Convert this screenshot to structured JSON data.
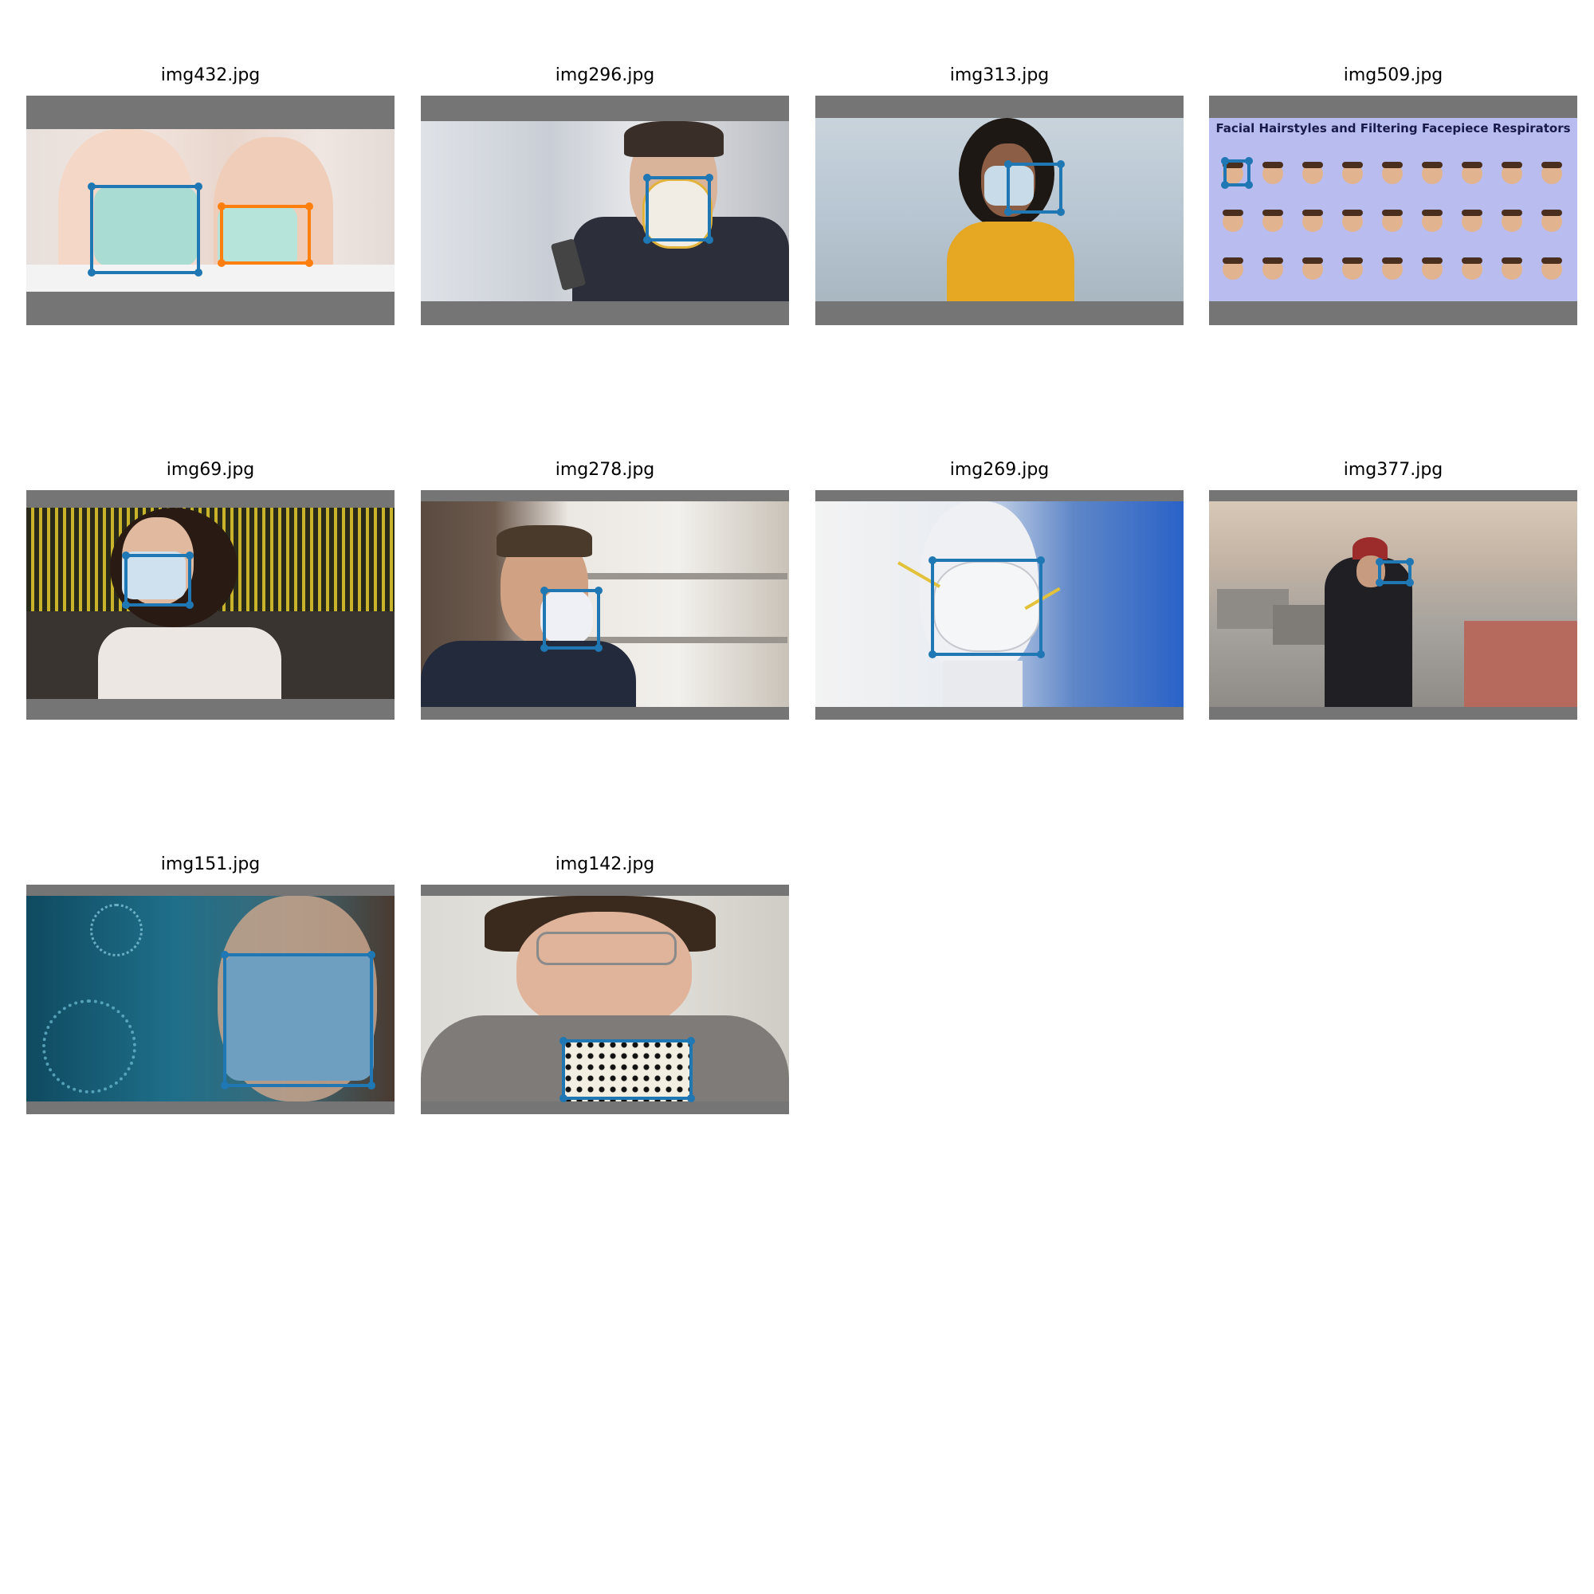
{
  "colors": {
    "box_primary": "#1f77b4",
    "box_secondary": "#ff7f0e",
    "letterbox": "#757575",
    "background": "#ffffff"
  },
  "tiles": [
    {
      "filename": "img432.jpg",
      "scene": "two-children-in-surgical-masks",
      "masks": 2
    },
    {
      "filename": "img296.jpg",
      "scene": "man-in-respirator-with-phone",
      "masks": 1
    },
    {
      "filename": "img313.jpg",
      "scene": "woman-in-yellow-sweater-street",
      "masks": 1
    },
    {
      "filename": "img509.jpg",
      "scene": "facial-hairstyles-poster",
      "masks": 1,
      "poster_title": "Facial Hairstyles and Filtering Facepiece Respirators"
    },
    {
      "filename": "img69.jpg",
      "scene": "woman-at-airport-departures-board",
      "masks": 1
    },
    {
      "filename": "img278.jpg",
      "scene": "man-in-n95-at-pharmacy-shelf",
      "masks": 1
    },
    {
      "filename": "img269.jpg",
      "scene": "mannequin-with-n95-respirator",
      "masks": 1
    },
    {
      "filename": "img377.jpg",
      "scene": "pedestrians-on-city-street",
      "masks": 1
    },
    {
      "filename": "img151.jpg",
      "scene": "woman-in-mask-with-virus-graphics",
      "masks": 1
    },
    {
      "filename": "img142.jpg",
      "scene": "man-holding-patterned-cloth-mask",
      "masks": 1
    }
  ]
}
